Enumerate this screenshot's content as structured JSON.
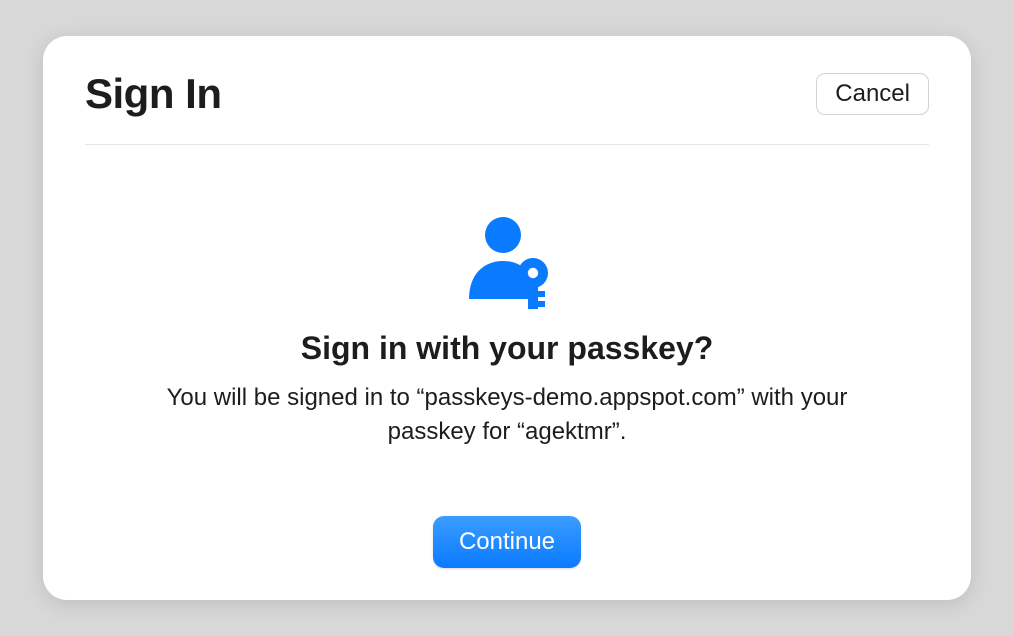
{
  "header": {
    "title": "Sign In",
    "cancel_label": "Cancel"
  },
  "prompt": {
    "title": "Sign in with your passkey?",
    "description": "You will be signed in to “passkeys-demo.appspot.com” with your passkey for “agektmr”.",
    "continue_label": "Continue"
  },
  "icon": {
    "name": "user-passkey-icon",
    "color": "#0a7aff"
  }
}
